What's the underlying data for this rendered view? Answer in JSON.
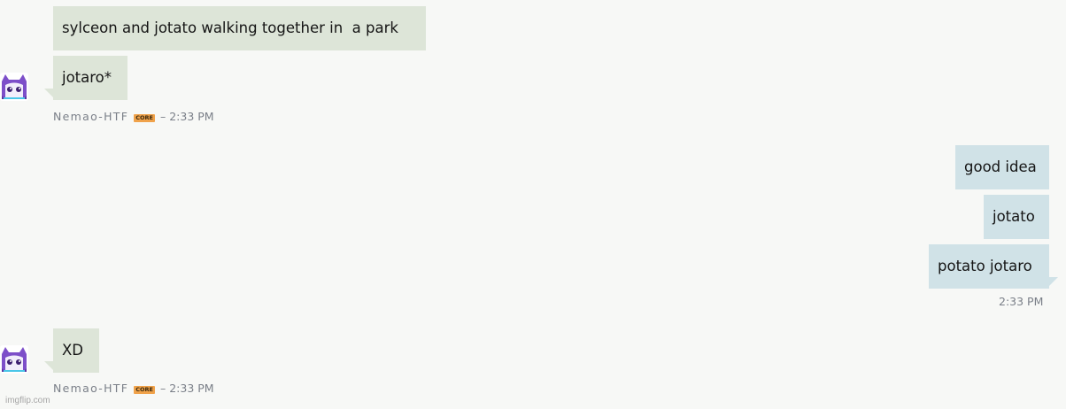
{
  "messages": {
    "group1": {
      "bubbles": [
        "sylceon and jotato walking together in  a park",
        "jotaro*"
      ],
      "sender": "Nemao-HTF",
      "badge": "CORE",
      "separator": "–",
      "time": "2:33 PM"
    },
    "group2": {
      "bubbles": [
        "good idea",
        "jotato",
        "potato jotaro"
      ],
      "time": "2:33 PM"
    },
    "group3": {
      "bubbles": [
        "XD"
      ],
      "sender": "Nemao-HTF",
      "badge": "CORE",
      "separator": "–",
      "time": "2:33 PM"
    }
  },
  "watermark": "imgflip.com",
  "colors": {
    "background": "#f7f8f6",
    "incoming_bubble": "#dde5d8",
    "outgoing_bubble": "#d0e2e7",
    "badge": "#f0a24a",
    "meta_text": "#7a7f88"
  },
  "icons": {
    "avatar": "purple-cat-avatar-icon"
  }
}
